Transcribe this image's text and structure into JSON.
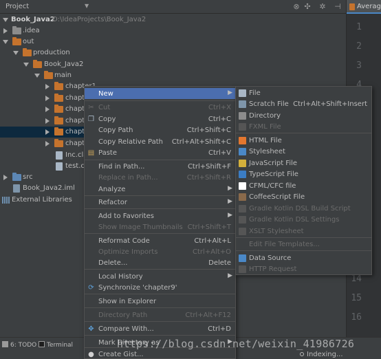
{
  "project_panel": {
    "title": "Project",
    "tree": {
      "root_name": "Book_Java2",
      "root_path": "D:\\IdeaProjects\\Book_Java2",
      "idea": ".idea",
      "out": "out",
      "production": "production",
      "book": "Book_Java2",
      "main": "main",
      "chapter1": "chapter1",
      "chapter2": "chapte",
      "chapter3": "chapte",
      "chapter4": "chapte",
      "chapter9": "chapte",
      "chapter10": "chapte",
      "inc": "Inc.cla",
      "test": "test.cla",
      "src": "src",
      "iml": "Book_Java2.iml",
      "ext_libs": "External Libraries"
    }
  },
  "editor": {
    "tab_label": "Average",
    "line_numbers": [
      "1",
      "2",
      "3",
      "4",
      "14",
      "15",
      "16"
    ]
  },
  "context_menu": {
    "new": "New",
    "cut": "Cut",
    "cut_sc": "Ctrl+X",
    "copy": "Copy",
    "copy_sc": "Ctrl+C",
    "copy_path": "Copy Path",
    "copy_path_sc": "Ctrl+Shift+C",
    "copy_rel": "Copy Relative Path",
    "copy_rel_sc": "Ctrl+Alt+Shift+C",
    "paste": "Paste",
    "paste_sc": "Ctrl+V",
    "find": "Find in Path...",
    "find_sc": "Ctrl+Shift+F",
    "replace": "Replace in Path...",
    "replace_sc": "Ctrl+Shift+R",
    "analyze": "Analyze",
    "refactor": "Refactor",
    "favorites": "Add to Favorites",
    "thumbs": "Show Image Thumbnails",
    "thumbs_sc": "Ctrl+Shift+T",
    "reformat": "Reformat Code",
    "reformat_sc": "Ctrl+Alt+L",
    "optimize": "Optimize Imports",
    "optimize_sc": "Ctrl+Alt+O",
    "delete": "Delete...",
    "delete_sc": "Delete",
    "local_history": "Local History",
    "sync": "Synchronize 'chapter9'",
    "explorer": "Show in Explorer",
    "dir_path": "Directory Path",
    "dir_path_sc": "Ctrl+Alt+F12",
    "compare": "Compare With...",
    "compare_sc": "Ctrl+D",
    "mark_dir": "Mark Directory as",
    "gist": "Create Gist..."
  },
  "submenu": {
    "file": "File",
    "scratch": "Scratch File",
    "scratch_sc": "Ctrl+Alt+Shift+Insert",
    "directory": "Directory",
    "fxml": "FXML File",
    "html": "HTML File",
    "stylesheet": "Stylesheet",
    "javascript": "JavaScript File",
    "typescript": "TypeScript File",
    "cfml": "CFML/CFC file",
    "coffee": "CoffeeScript File",
    "gradle_build": "Gradle Kotlin DSL Build Script",
    "gradle_settings": "Gradle Kotlin DSL Settings",
    "xslt": "XSLT Stylesheet",
    "edit_templates": "Edit File Templates...",
    "datasource": "Data Source",
    "http": "HTTP Request"
  },
  "statusbar": {
    "todo": "6: TODO",
    "terminal": "Terminal",
    "indexing": "Indexing..."
  },
  "watermark": "https://blog.csdn.net/weixin_41986726",
  "colors": {
    "highlight": "#4b6eaf",
    "panel_bg": "#3c3f41",
    "selection": "#0d293e",
    "folder": "#c5732d"
  }
}
